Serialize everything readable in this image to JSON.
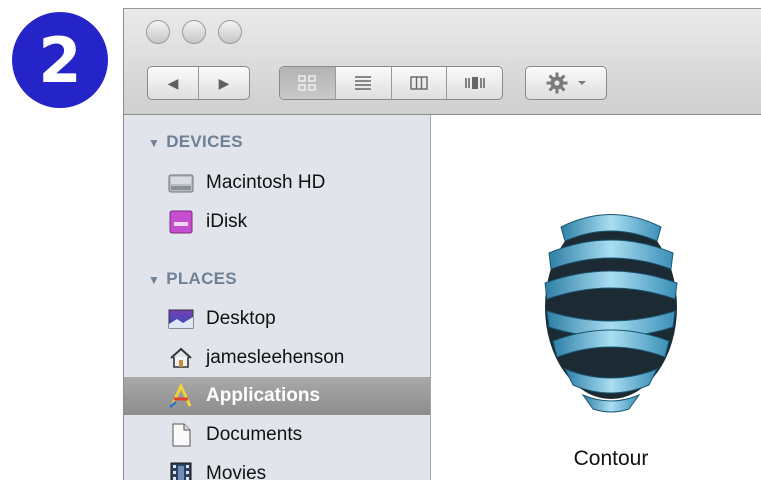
{
  "step": {
    "number": "2",
    "color": "#2424c8"
  },
  "toolbar": {
    "back_icon": "◀",
    "forward_icon": "▶",
    "view_modes": [
      "icon-view",
      "list-view",
      "column-view",
      "coverflow-view"
    ],
    "active_view": "icon-view",
    "action_icon": "gear-icon"
  },
  "sidebar": {
    "devices_header": "DEVICES",
    "devices": [
      {
        "label": "Macintosh HD",
        "icon": "hard-drive-icon"
      },
      {
        "label": "iDisk",
        "icon": "idisk-icon"
      }
    ],
    "places_header": "PLACES",
    "places": [
      {
        "label": "Desktop",
        "icon": "desktop-icon"
      },
      {
        "label": "jamesleehenson",
        "icon": "home-icon"
      },
      {
        "label": "Applications",
        "icon": "applications-icon",
        "selected": true
      },
      {
        "label": "Documents",
        "icon": "documents-icon"
      },
      {
        "label": "Movies",
        "icon": "movies-icon"
      }
    ]
  },
  "content": {
    "items": [
      {
        "label": "Contour",
        "icon": "contour-app-icon"
      }
    ]
  }
}
